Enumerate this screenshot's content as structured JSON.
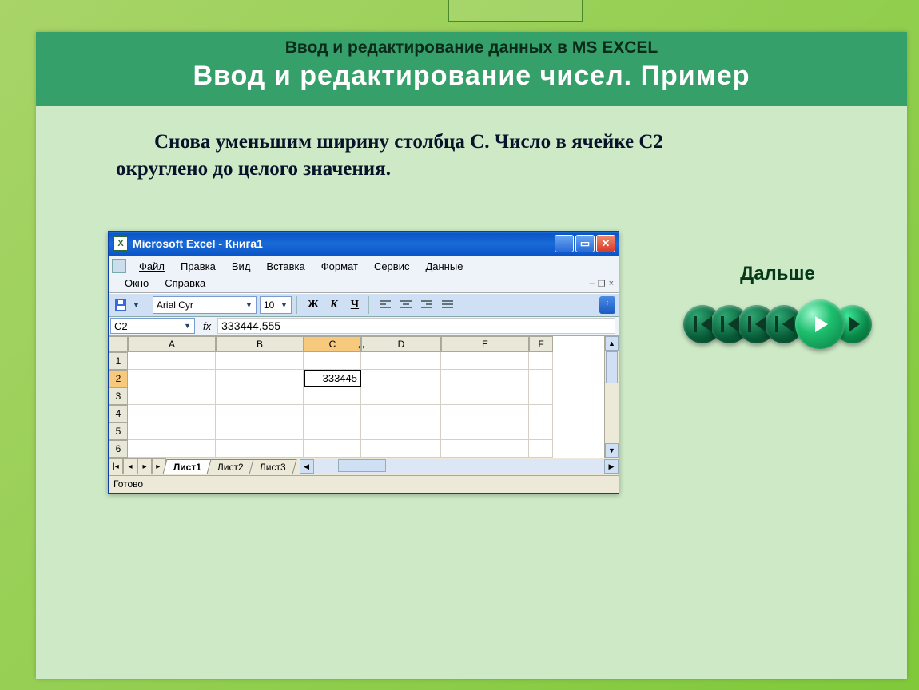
{
  "slide": {
    "super_title": "Ввод и редактирование данных в MS EXCEL",
    "main_title": "Ввод  и  редактирование  чисел.  Пример",
    "body_text_1": "Снова уменьшим ширину столбца С. Число в ячейке С2",
    "body_text_2": "округлено до целого значения.",
    "next_label": "Дальше"
  },
  "excel": {
    "title": "Microsoft Excel - Книга1",
    "menu": {
      "file": "Файл",
      "edit": "Правка",
      "view": "Вид",
      "insert": "Вставка",
      "format": "Формат",
      "tools": "Сервис",
      "data": "Данные",
      "window": "Окно",
      "help": "Справка"
    },
    "toolbar": {
      "font_name": "Arial Cyr",
      "font_size": "10",
      "bold": "Ж",
      "italic": "К",
      "underline": "Ч"
    },
    "name_box": "C2",
    "fx_label": "fx",
    "formula": "333444,555",
    "columns": [
      "A",
      "B",
      "C",
      "D",
      "E",
      "F"
    ],
    "rows": [
      "1",
      "2",
      "3",
      "4",
      "5",
      "6"
    ],
    "active_cell_value": "333445",
    "sheets": {
      "s1": "Лист1",
      "s2": "Лист2",
      "s3": "Лист3"
    },
    "status": "Готово"
  }
}
